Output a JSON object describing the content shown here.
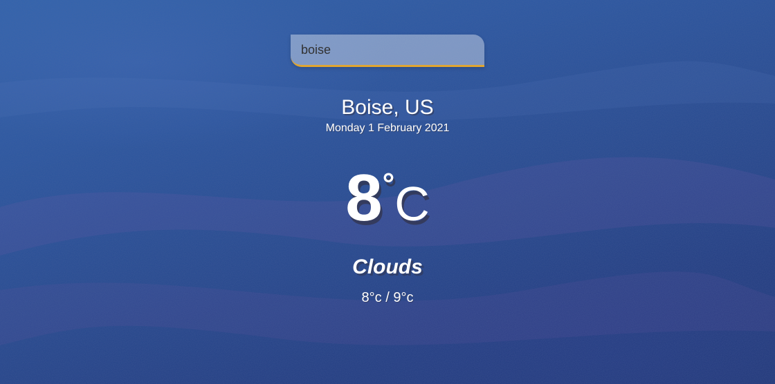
{
  "search": {
    "value": "boise",
    "placeholder": "Search..."
  },
  "location": {
    "name": "Boise, US",
    "date": "Monday 1 February 2021"
  },
  "current": {
    "temp_value": "8",
    "temp_degree": "°",
    "temp_unit": "C",
    "weather": "Clouds",
    "range": "8°c / 9°c"
  },
  "colors": {
    "accent_underline": "#e0a530",
    "background": "#2a56a0",
    "text": "#ffffff"
  }
}
